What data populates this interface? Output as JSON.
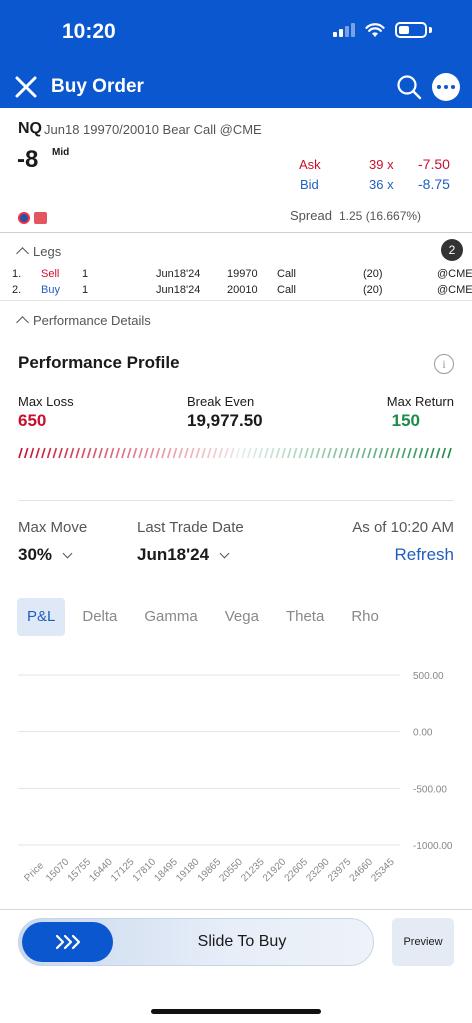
{
  "status": {
    "time": "10:20"
  },
  "header": {
    "title": "Buy Order",
    "close_icon": "close-icon",
    "search_icon": "search-icon",
    "more_icon": "more-icon"
  },
  "quote": {
    "symbol": "NQ",
    "description": "Jun18 19970/20010 Bear Call @CME",
    "quantity": "-8",
    "mid_label": "Mid",
    "ask_label": "Ask",
    "ask_size": "39 x",
    "ask_price": "-7.50",
    "bid_label": "Bid",
    "bid_size": "36 x",
    "bid_price": "-8.75",
    "spread_label": "Spread",
    "spread_value": "1.25 (16.667%)",
    "colors": {
      "ask": "#c8102e",
      "bid": "#1f5fbf"
    }
  },
  "legs": {
    "label": "Legs",
    "count": "2",
    "rows": [
      {
        "idx": "1.",
        "side": "Sell",
        "qty": "1",
        "expiry": "Jun18'24",
        "strike": "19970",
        "type": "Call",
        "paren": "(20)",
        "exchange": "@CME"
      },
      {
        "idx": "2.",
        "side": "Buy",
        "qty": "1",
        "expiry": "Jun18'24",
        "strike": "20010",
        "type": "Call",
        "paren": "(20)",
        "exchange": "@CME"
      }
    ]
  },
  "performance": {
    "details_label": "Performance Details",
    "title": "Performance Profile",
    "max_loss_label": "Max Loss",
    "max_loss": "650",
    "break_even_label": "Break Even",
    "break_even": "19,977.50",
    "max_return_label": "Max Return",
    "max_return": "150",
    "max_move_label": "Max Move",
    "max_move": "30%",
    "last_trade_label": "Last Trade Date",
    "last_trade": "Jun18'24",
    "as_of": "As of 10:20 AM",
    "refresh": "Refresh",
    "tabs": [
      "P&L",
      "Delta",
      "Gamma",
      "Vega",
      "Theta",
      "Rho"
    ],
    "active_tab": "P&L"
  },
  "chart_data": {
    "type": "line",
    "y_ticks": [
      "500.00",
      "0.00",
      "-500.00",
      "-1000.00"
    ],
    "x_ticks": [
      "Price",
      "15070",
      "15755",
      "16440",
      "17125",
      "17810",
      "18495",
      "19180",
      "19865",
      "20550",
      "21235",
      "21920",
      "22605",
      "23290",
      "23975",
      "24660",
      "25345"
    ],
    "ylim": [
      -1000,
      500
    ],
    "grid": true,
    "series": []
  },
  "footer": {
    "slide_label": "Slide To Buy",
    "preview_label": "Preview",
    "slide_icon": "chevrons-right-icon"
  }
}
